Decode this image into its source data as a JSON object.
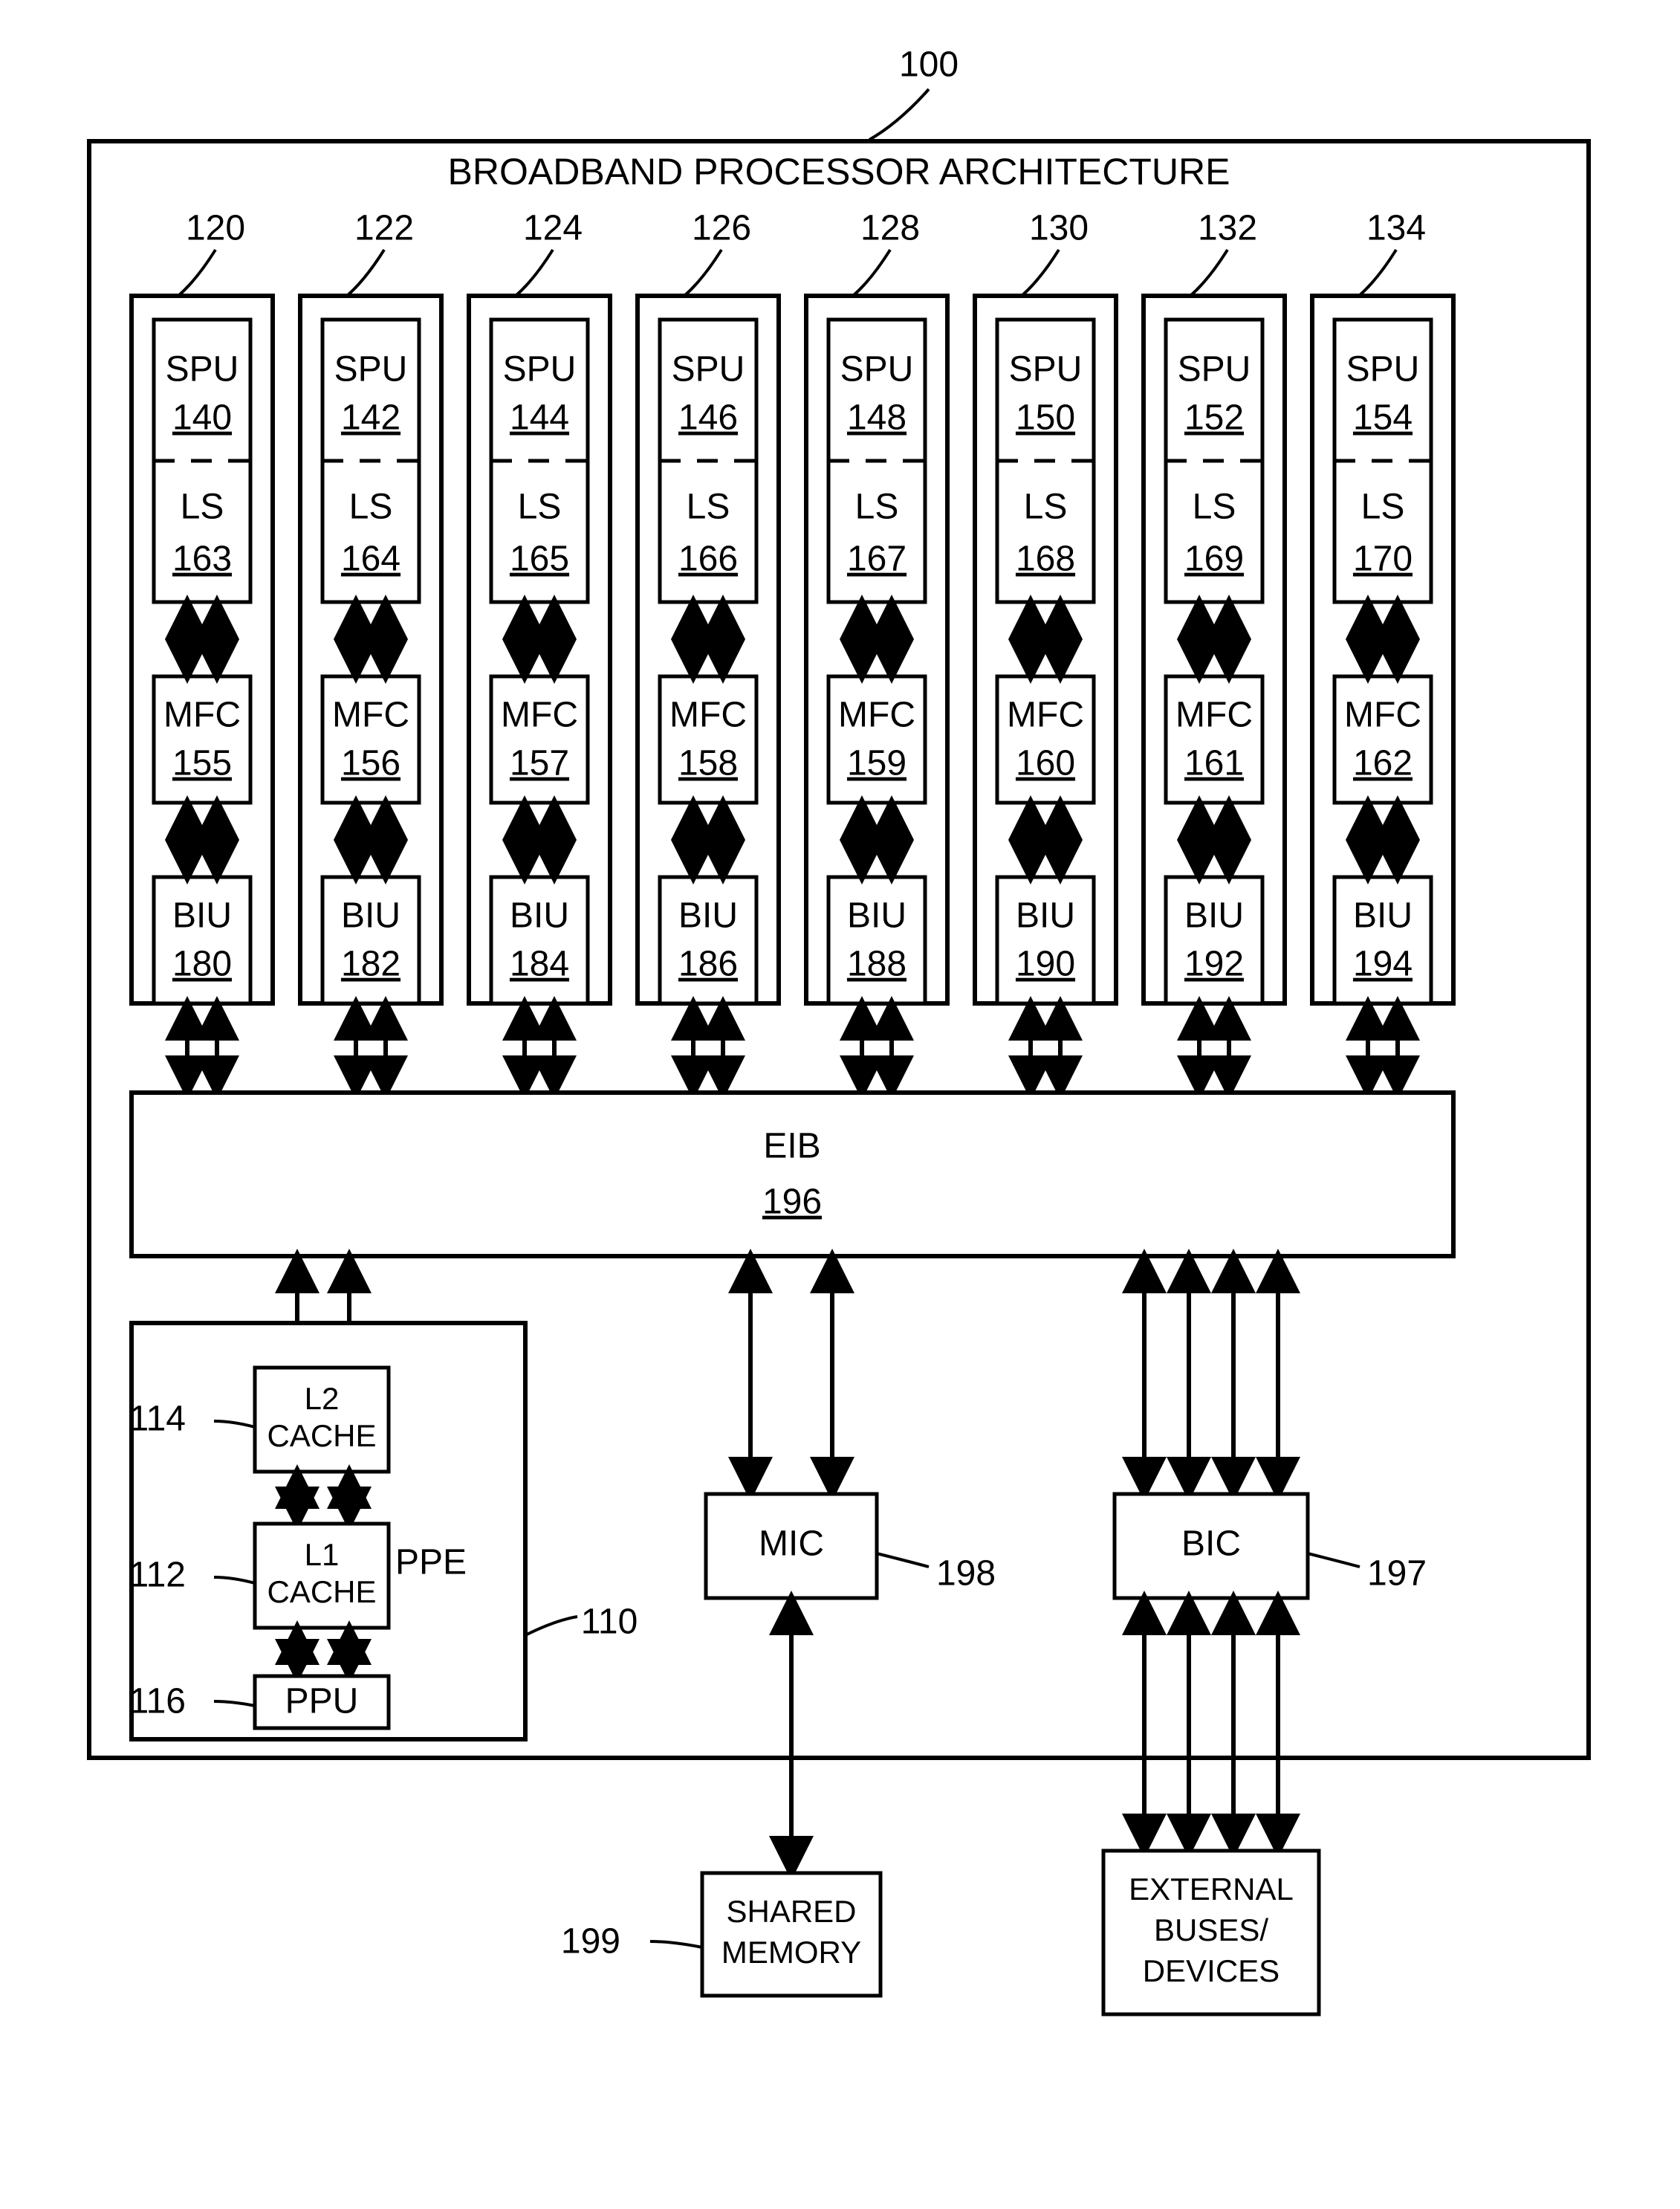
{
  "diagram": {
    "title": "BROADBAND PROCESSOR ARCHITECTURE",
    "outer_ref": "100",
    "spe_refs": [
      "120",
      "122",
      "124",
      "126",
      "128",
      "130",
      "132",
      "134"
    ],
    "spu_label": "SPU",
    "spu_nums": [
      "140",
      "142",
      "144",
      "146",
      "148",
      "150",
      "152",
      "154"
    ],
    "ls_label": "LS",
    "ls_nums": [
      "163",
      "164",
      "165",
      "166",
      "167",
      "168",
      "169",
      "170"
    ],
    "mfc_label": "MFC",
    "mfc_nums": [
      "155",
      "156",
      "157",
      "158",
      "159",
      "160",
      "161",
      "162"
    ],
    "biu_label": "BIU",
    "biu_nums": [
      "180",
      "182",
      "184",
      "186",
      "188",
      "190",
      "192",
      "194"
    ],
    "eib_label": "EIB",
    "eib_num": "196",
    "ppe": {
      "container_label": "PPE",
      "container_ref": "110",
      "l2_label_line1": "L2",
      "l2_label_line2": "CACHE",
      "l2_ref": "114",
      "l1_label_line1": "L1",
      "l1_label_line2": "CACHE",
      "l1_ref": "112",
      "ppu_label": "PPU",
      "ppu_ref": "116"
    },
    "mic_label": "MIC",
    "mic_ref": "198",
    "bic_label": "BIC",
    "bic_ref": "197",
    "shared_memory_line1": "SHARED",
    "shared_memory_line2": "MEMORY",
    "shared_memory_ref": "199",
    "external_line1": "EXTERNAL",
    "external_line2": "BUSES/",
    "external_line3": "DEVICES"
  }
}
